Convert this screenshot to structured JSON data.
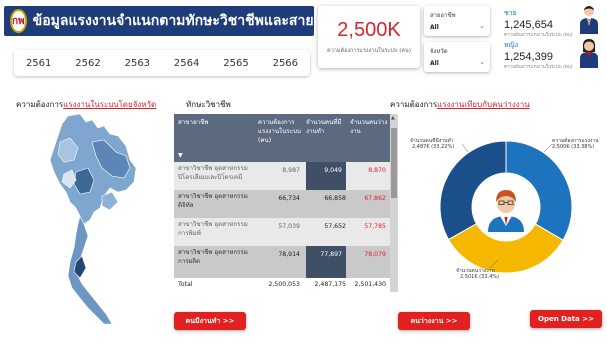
{
  "header": {
    "title": "ข้อมูลแรงงานจำแนกตามทักษะวิชาชีพและสายอาชีพ",
    "logo_text": "กพ"
  },
  "years": [
    "2561",
    "2562",
    "2563",
    "2564",
    "2565",
    "2566"
  ],
  "kpi": {
    "value": "2,500K",
    "label": "ความต้องการแรงงานในระบบ (คน)"
  },
  "filters": [
    {
      "label": "สายอาชีพ",
      "value": "All"
    },
    {
      "label": "จังหวัด",
      "value": "All"
    }
  ],
  "stats": {
    "male": {
      "label": "ชาย",
      "value": "1,245,654",
      "sub": "ความต้องการแรงงานในระบบ (คน)"
    },
    "female": {
      "label": "หญิง",
      "value": "1,254,399",
      "sub": "ความต้องการแรงงานในระบบ (คน)"
    }
  },
  "sections": {
    "map_title_prefix": "ความต้องการ",
    "map_title_hl": "แรงงานในระบบโดยจังหวัด",
    "table_title": "ทักษะวิชาชีพ",
    "donut_title_prefix": "ความต้องการ",
    "donut_title_hl": "แรงงานเทียบกับคนว่างงาน"
  },
  "table": {
    "headers": [
      "สาขาอาชีพ",
      "ความต้องการแรงงานในระบบ (คน)",
      "จำนวนคนที่มีงานทำ",
      "จำนวนคนว่างงาน"
    ],
    "rows": [
      {
        "name": "สาขาวิชาชีพ อุตสาหกรรมปิโตรเลียมและปิโตรเคมี",
        "demand": "8,987",
        "employed": "9,049",
        "unemployed": "8,870"
      },
      {
        "name": "สาขาวิชาชีพ อุตสาหกรรมดิจิทัล",
        "demand": "66,734",
        "employed": "66,858",
        "unemployed": "67,862"
      },
      {
        "name": "สาขาวิชาชีพ อุตสาหกรรมการพิมพ์",
        "demand": "57,039",
        "employed": "57,652",
        "unemployed": "57,785"
      },
      {
        "name": "สาขาวิชาชีพ อุตสาหกรรมการผลิต",
        "demand": "78,914",
        "employed": "77,897",
        "unemployed": "78,079"
      }
    ],
    "total": {
      "label": "Total",
      "demand": "2,500,053",
      "employed": "2,487,175",
      "unemployed": "2,501,430"
    }
  },
  "donut": {
    "slices": [
      {
        "label": "จำนวนคนที่มีงานทำ",
        "value": "2,487K (33.22%)",
        "share": 33.22,
        "color": "#1b4f8c"
      },
      {
        "label": "ความต้องการแรงงาน",
        "value": "2,500K (33.38%)",
        "share": 33.38,
        "color": "#1e73be"
      },
      {
        "label": "จำนวนคนว่างงาน",
        "value": "2,501K (33.4%)",
        "share": 33.4,
        "color": "#f5b700"
      }
    ]
  },
  "buttons": {
    "employed": "คนมีงานทำ >>",
    "unemployed": "คนว่างงาน >>",
    "open_data": "Open Data >>"
  },
  "colors": {
    "accent_red": "#d9232e",
    "navy": "#1f3c7a",
    "blue": "#1e73be",
    "yellow": "#f5b700"
  }
}
